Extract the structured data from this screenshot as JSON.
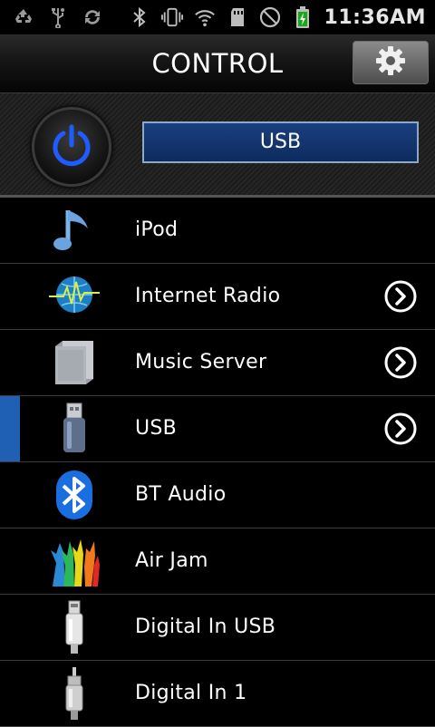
{
  "status_bar": {
    "time": "11:36AM",
    "left_icons": [
      "recycle-icon",
      "usb-icon",
      "sync-icon"
    ],
    "right_icons": [
      "bluetooth-icon",
      "vibrate-icon",
      "wifi-icon",
      "sd-card-icon",
      "no-sound-icon",
      "battery-charging-icon"
    ]
  },
  "header": {
    "title": "CONTROL",
    "settings_icon": "gear-icon"
  },
  "control": {
    "power_icon": "power-icon",
    "current_source": "USB"
  },
  "sources": [
    {
      "label": "iPod",
      "icon": "music-note-icon",
      "has_arrow": false,
      "selected": false
    },
    {
      "label": "Internet Radio",
      "icon": "globe-waveform-icon",
      "has_arrow": true,
      "selected": false
    },
    {
      "label": "Music Server",
      "icon": "server-icon",
      "has_arrow": true,
      "selected": false
    },
    {
      "label": "USB",
      "icon": "usb-stick-icon",
      "has_arrow": true,
      "selected": true
    },
    {
      "label": "BT Audio",
      "icon": "bluetooth-logo-icon",
      "has_arrow": false,
      "selected": false
    },
    {
      "label": "Air Jam",
      "icon": "dancers-icon",
      "has_arrow": false,
      "selected": false
    },
    {
      "label": "Digital In USB",
      "icon": "usb-plug-icon",
      "has_arrow": false,
      "selected": false
    },
    {
      "label": "Digital In 1",
      "icon": "rca-plug-icon",
      "has_arrow": false,
      "selected": false
    }
  ],
  "colors": {
    "selected_marker": "#1f5fb4",
    "power_accent": "#1f5cff",
    "source_box": "#123a78"
  }
}
